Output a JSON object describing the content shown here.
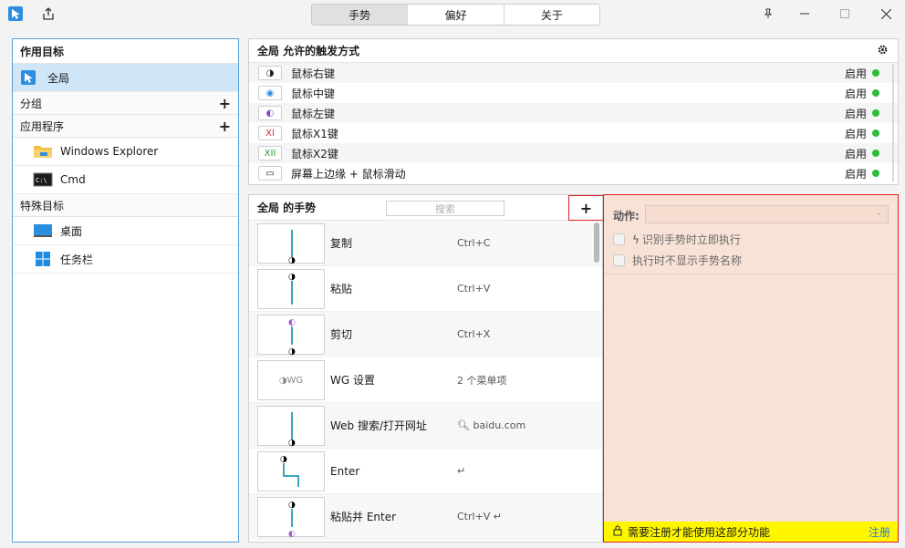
{
  "tabs": [
    "手势",
    "偏好",
    "关于"
  ],
  "active_tab": 0,
  "left": {
    "header": "作用目标",
    "global": "全局",
    "group_label": "分组",
    "apps_label": "应用程序",
    "apps": [
      "Windows Explorer",
      "Cmd"
    ],
    "special_label": "特殊目标",
    "special": [
      "桌面",
      "任务栏"
    ]
  },
  "triggers": {
    "title": "全局 允许的触发方式",
    "enabled_label": "启用",
    "items": [
      {
        "name": "鼠标右键",
        "icon": "◑"
      },
      {
        "name": "鼠标中键",
        "icon": "◉"
      },
      {
        "name": "鼠标左键",
        "icon": "◐"
      },
      {
        "name": "鼠标X1键",
        "icon": "XI"
      },
      {
        "name": "鼠标X2键",
        "icon": "XII"
      },
      {
        "name": "屏幕上边缘 + 鼠标滑动",
        "icon": "▭"
      }
    ]
  },
  "gestures": {
    "title": "全局 的手势",
    "search_placeholder": "搜索",
    "add_label": "+",
    "items": [
      {
        "name": "复制",
        "key": "Ctrl+C"
      },
      {
        "name": "粘贴",
        "key": "Ctrl+V"
      },
      {
        "name": "剪切",
        "key": "Ctrl+X"
      },
      {
        "name": "WG 设置",
        "key": "2 个菜单项"
      },
      {
        "name": "Web 搜索/打开网址",
        "key": "baidu.com"
      },
      {
        "name": "Enter",
        "key": "↵"
      },
      {
        "name": "粘贴并 Enter",
        "key": "Ctrl+V  ↵"
      }
    ],
    "wg_thumb_label": "◑WG"
  },
  "action": {
    "label": "动作:",
    "opt1": "识别手势时立即执行",
    "opt2": "执行时不显示手势名称",
    "register_msg": "需要注册才能使用这部分功能",
    "register_link": "注册"
  },
  "colors": {
    "accent": "#5a9fd6",
    "highlight_border": "#e02020",
    "enabled_dot": "#2ebd3a",
    "register_bar": "#fff600",
    "gesture_line": "#3aa7b8"
  }
}
